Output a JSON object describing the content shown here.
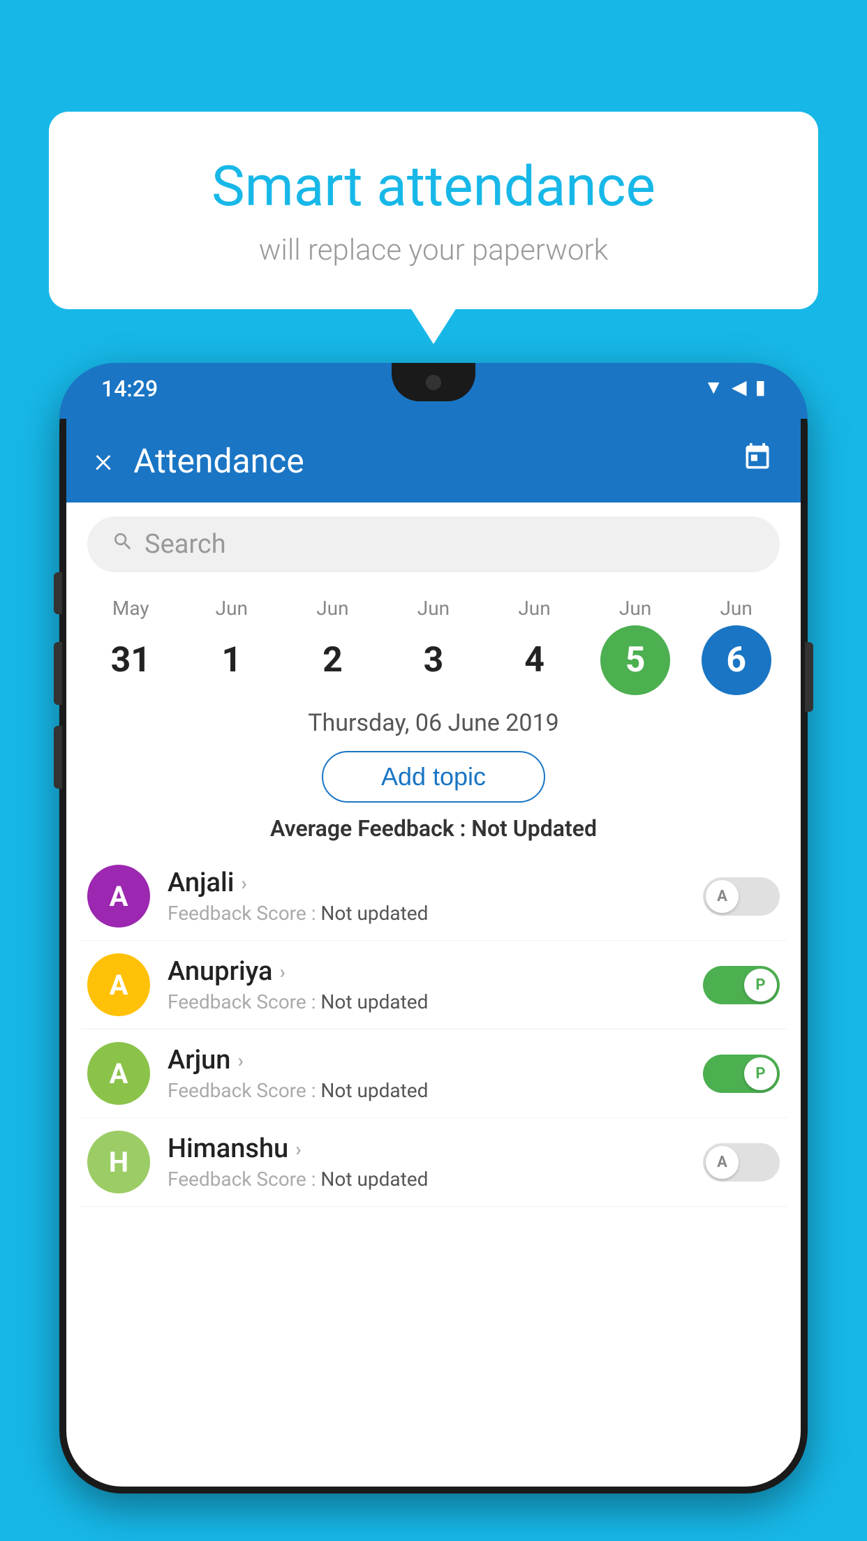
{
  "background_color": "#17B8E8",
  "speech_bubble": {
    "title": "Smart attendance",
    "subtitle": "will replace your paperwork"
  },
  "status_bar": {
    "time": "14:29",
    "icons": [
      "wifi",
      "signal",
      "battery"
    ]
  },
  "app_header": {
    "title": "Attendance",
    "close_label": "×",
    "calendar_label": "📅"
  },
  "search": {
    "placeholder": "Search"
  },
  "calendar": {
    "days": [
      {
        "month": "May",
        "date": "31",
        "style": "normal"
      },
      {
        "month": "Jun",
        "date": "1",
        "style": "normal"
      },
      {
        "month": "Jun",
        "date": "2",
        "style": "normal"
      },
      {
        "month": "Jun",
        "date": "3",
        "style": "normal"
      },
      {
        "month": "Jun",
        "date": "4",
        "style": "normal"
      },
      {
        "month": "Jun",
        "date": "5",
        "style": "today"
      },
      {
        "month": "Jun",
        "date": "6",
        "style": "selected"
      }
    ],
    "selected_date_label": "Thursday, 06 June 2019"
  },
  "add_topic_button": "Add topic",
  "average_feedback": {
    "label": "Average Feedback :",
    "value": "Not Updated"
  },
  "students": [
    {
      "name": "Anjali",
      "initials": "A",
      "avatar_color": "#9C27B0",
      "feedback_label": "Feedback Score :",
      "feedback_value": "Not updated",
      "attendance": "absent",
      "toggle_letter": "A"
    },
    {
      "name": "Anupriya",
      "initials": "A",
      "avatar_color": "#FFC107",
      "feedback_label": "Feedback Score :",
      "feedback_value": "Not updated",
      "attendance": "present",
      "toggle_letter": "P"
    },
    {
      "name": "Arjun",
      "initials": "A",
      "avatar_color": "#8BC34A",
      "feedback_label": "Feedback Score :",
      "feedback_value": "Not updated",
      "attendance": "present",
      "toggle_letter": "P"
    },
    {
      "name": "Himanshu",
      "initials": "H",
      "avatar_color": "#9CCC65",
      "feedback_label": "Feedback Score :",
      "feedback_value": "Not updated",
      "attendance": "absent",
      "toggle_letter": "A"
    }
  ]
}
